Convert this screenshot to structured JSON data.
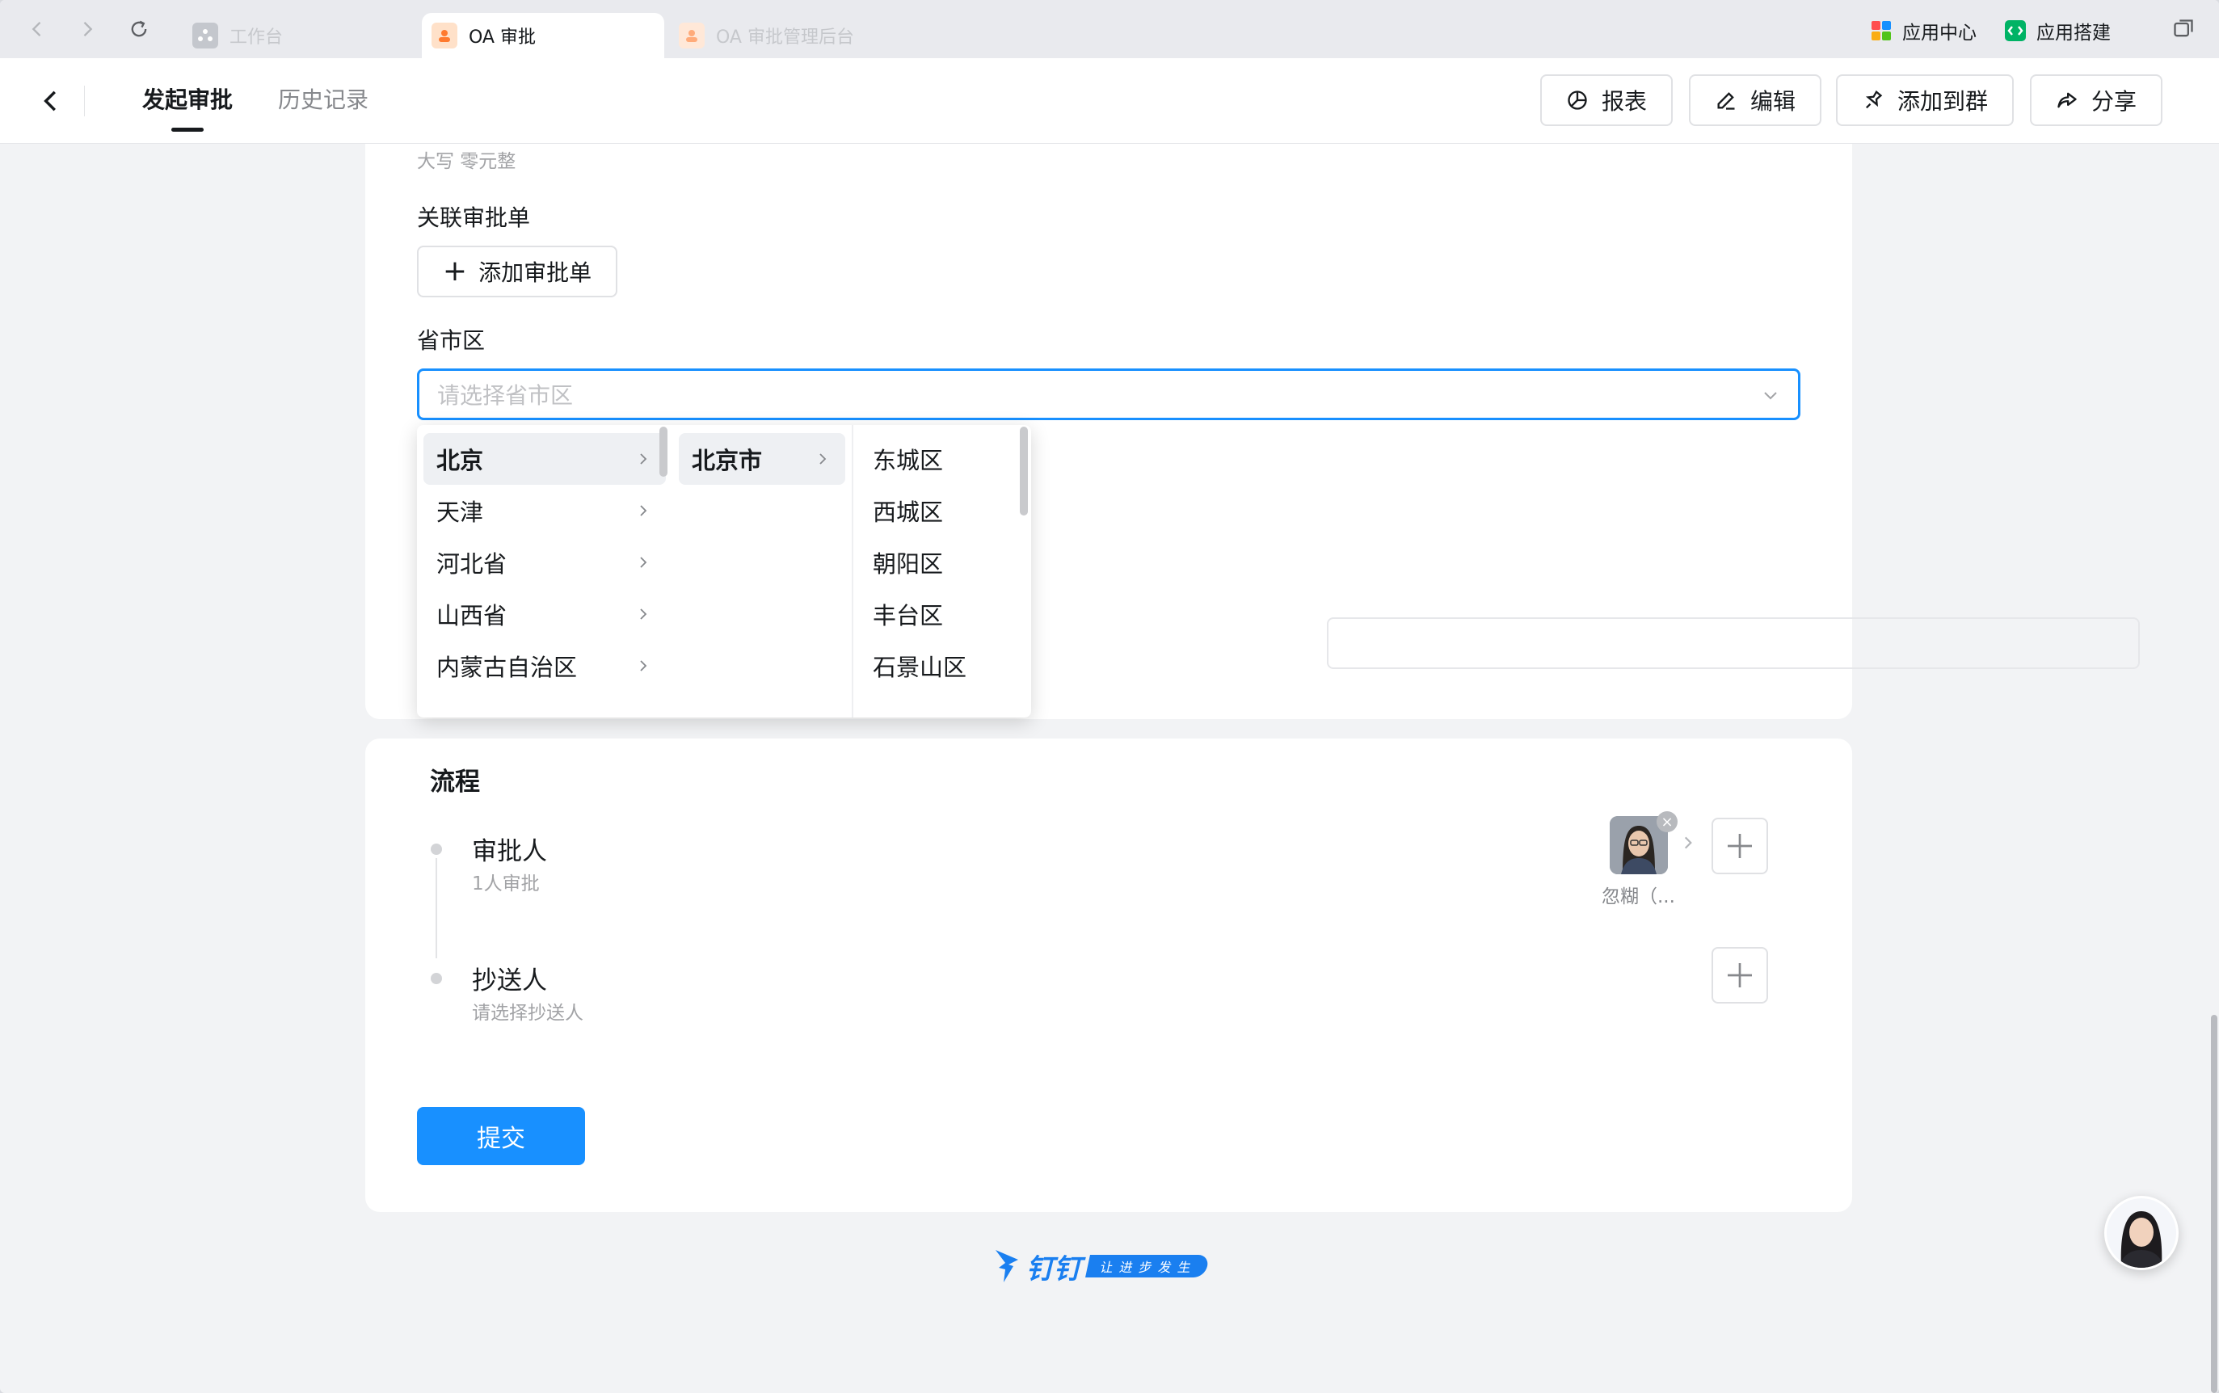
{
  "browser": {
    "tabs": [
      {
        "label": "工作台",
        "icon": "workbench-icon",
        "active": false
      },
      {
        "label": "OA 审批",
        "icon": "oa-approval-icon",
        "active": true
      },
      {
        "label": "OA 审批管理后台",
        "icon": "oa-admin-icon",
        "active": false
      }
    ],
    "right_links": [
      {
        "label": "应用中心",
        "icon": "app-center-icon"
      },
      {
        "label": "应用搭建",
        "icon": "app-builder-icon"
      }
    ]
  },
  "header": {
    "tabs": [
      {
        "label": "发起审批",
        "active": true
      },
      {
        "label": "历史记录",
        "active": false
      }
    ],
    "actions": [
      {
        "label": "报表",
        "icon": "report-icon"
      },
      {
        "label": "编辑",
        "icon": "edit-icon"
      },
      {
        "label": "添加到群",
        "icon": "pin-icon"
      },
      {
        "label": "分享",
        "icon": "share-icon"
      }
    ]
  },
  "form": {
    "amount_uppercase_hint": "大写 零元整",
    "related_label": "关联审批单",
    "add_related_button": "添加审批单",
    "region_label": "省市区",
    "region_placeholder": "请选择省市区"
  },
  "cascader": {
    "provinces": [
      "北京",
      "天津",
      "河北省",
      "山西省",
      "内蒙古自治区"
    ],
    "cities": [
      "北京市"
    ],
    "districts": [
      "东城区",
      "西城区",
      "朝阳区",
      "丰台区",
      "石景山区"
    ],
    "selected_province": "北京",
    "selected_city": "北京市"
  },
  "process": {
    "title": "流程",
    "approver": {
      "title": "审批人",
      "subtitle": "1人审批",
      "person_name": "忽糊（..."
    },
    "cc": {
      "title": "抄送人",
      "subtitle": "请选择抄送人"
    },
    "submit_label": "提交"
  },
  "brand": {
    "name": "钉钉",
    "slogan": "让进步发生"
  },
  "colors": {
    "primary": "#1890ff",
    "brand": "#1a7ff0"
  }
}
